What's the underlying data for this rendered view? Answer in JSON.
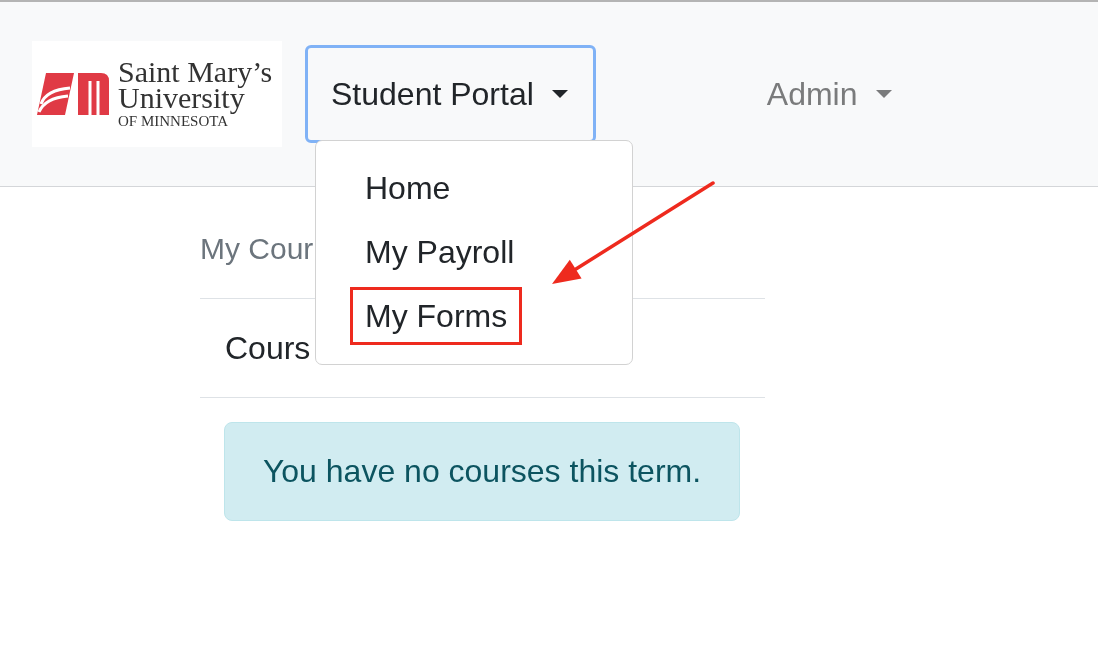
{
  "navbar": {
    "logo": {
      "lines": [
        "Saint Mary’s",
        "University",
        "OF MINNESOTA"
      ]
    },
    "menus": [
      {
        "label": "Student Portal",
        "focused": true,
        "expanded": true,
        "items": [
          {
            "label": "Home",
            "highlighted": false
          },
          {
            "label": "My Payroll",
            "highlighted": false
          },
          {
            "label": "My Forms",
            "highlighted": true
          }
        ]
      },
      {
        "label": "Admin",
        "focused": false,
        "expanded": false
      }
    ]
  },
  "content": {
    "heading": "My Cour",
    "table": {
      "columns": [
        "Cours"
      ]
    },
    "alert": {
      "text": "You have no courses this term."
    }
  }
}
